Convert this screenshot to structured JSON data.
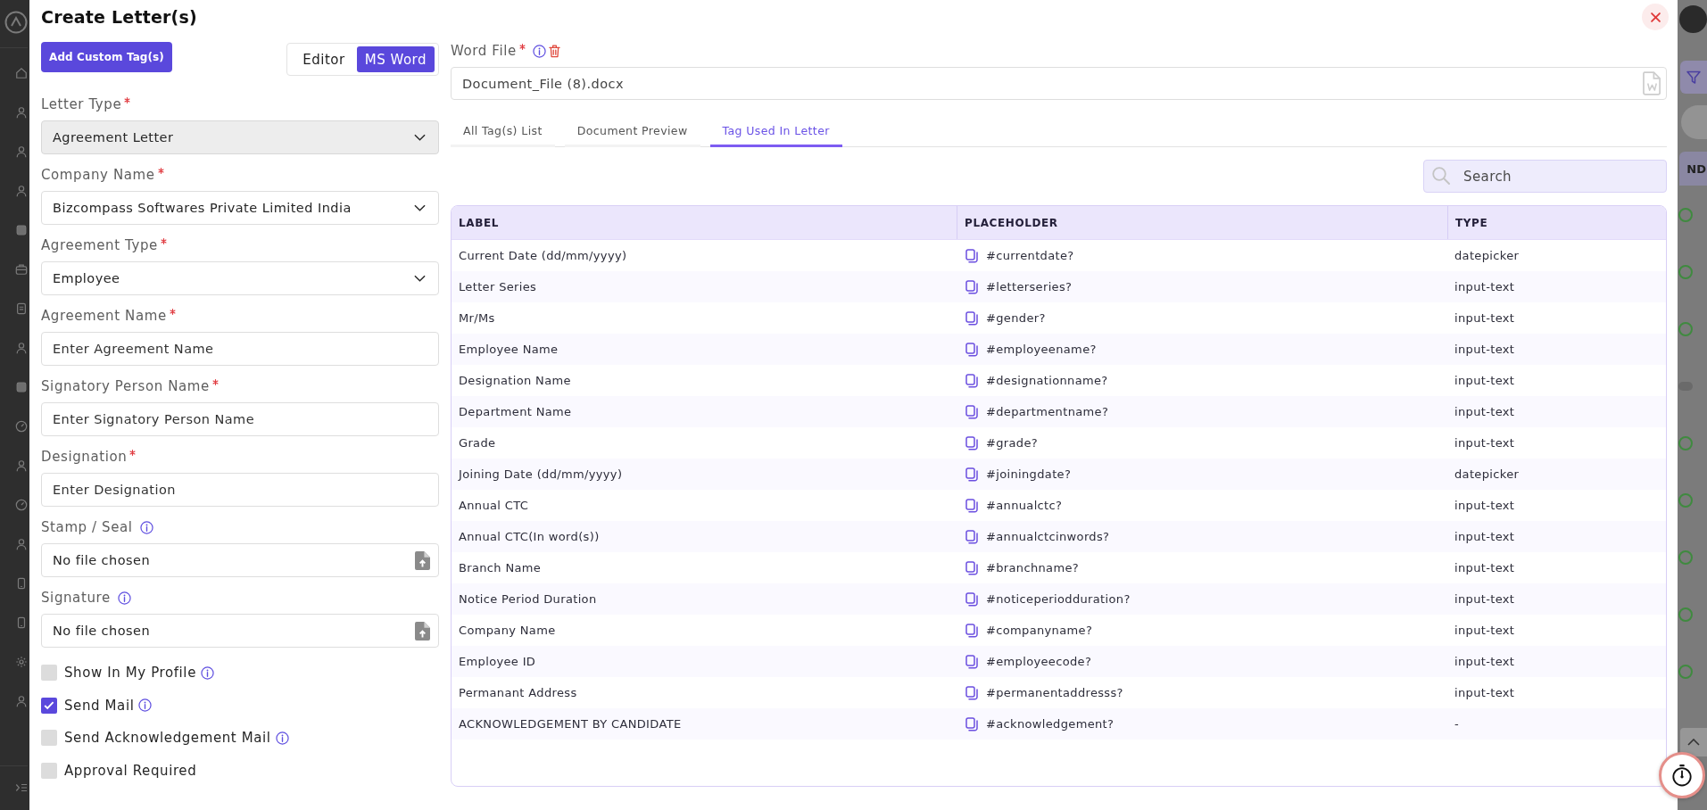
{
  "dialog": {
    "title": "Create Letter(s)"
  },
  "toolbar": {
    "add_button": "Add Custom Tag(s)",
    "modes": [
      {
        "label": "Editor",
        "selected": false
      },
      {
        "label": "MS Word",
        "selected": true
      }
    ]
  },
  "form_fields": [
    {
      "kind": "select",
      "label": "Letter Type",
      "required": true,
      "info": false,
      "value": "Agreement Letter",
      "disabled": true
    },
    {
      "kind": "select",
      "label": "Company Name",
      "required": true,
      "info": false,
      "value": "Bizcompass Softwares Private Limited India",
      "disabled": false
    },
    {
      "kind": "select",
      "label": "Agreement Type",
      "required": true,
      "info": false,
      "value": "Employee",
      "disabled": false
    },
    {
      "kind": "text",
      "label": "Agreement Name",
      "required": true,
      "info": false,
      "placeholder": "Enter Agreement Name",
      "disabled": false
    },
    {
      "kind": "text",
      "label": "Signatory Person Name",
      "required": true,
      "info": false,
      "placeholder": "Enter Signatory Person Name",
      "disabled": false
    },
    {
      "kind": "text",
      "label": "Designation",
      "required": true,
      "info": false,
      "placeholder": "Enter Designation",
      "disabled": false
    },
    {
      "kind": "file",
      "label": "Stamp / Seal",
      "required": false,
      "info": true,
      "value": "No file chosen",
      "disabled": false
    },
    {
      "kind": "file",
      "label": "Signature",
      "required": false,
      "info": true,
      "value": "No file chosen",
      "disabled": false
    }
  ],
  "options": [
    {
      "label": "Show In My Profile",
      "checked": false,
      "info": true
    },
    {
      "label": "Send Mail",
      "checked": true,
      "info": true
    },
    {
      "label": "Send Acknowledgement Mail",
      "checked": false,
      "info": true
    },
    {
      "label": "Approval Required",
      "checked": false,
      "info": false
    }
  ],
  "word_file": {
    "label": "Word File",
    "required": true,
    "info": true,
    "value": "Document_File (8).docx"
  },
  "tabs": [
    {
      "label": "All Tag(s) List",
      "selected": false
    },
    {
      "label": "Document Preview",
      "selected": false
    },
    {
      "label": "Tag Used In Letter",
      "selected": true
    }
  ],
  "search": {
    "placeholder": "Search"
  },
  "table": {
    "columns": [
      "LABEL",
      "PLACEHOLDER",
      "TYPE"
    ],
    "rows": [
      {
        "label": "Current Date (dd/mm/yyyy)",
        "tag": "#currentdate?",
        "type": "datepicker"
      },
      {
        "label": "Letter Series",
        "tag": "#letterseries?",
        "type": "input-text"
      },
      {
        "label": "Mr/Ms",
        "tag": "#gender?",
        "type": "input-text"
      },
      {
        "label": "Employee Name",
        "tag": "#employeename?",
        "type": "input-text"
      },
      {
        "label": "Designation Name",
        "tag": "#designationname?",
        "type": "input-text"
      },
      {
        "label": "Department Name",
        "tag": "#departmentname?",
        "type": "input-text"
      },
      {
        "label": "Grade",
        "tag": "#grade?",
        "type": "input-text"
      },
      {
        "label": "Joining Date (dd/mm/yyyy)",
        "tag": "#joiningdate?",
        "type": "datepicker"
      },
      {
        "label": "Annual CTC",
        "tag": "#annualctc?",
        "type": "input-text"
      },
      {
        "label": "Annual CTC(In word(s))",
        "tag": "#annualctcinwords?",
        "type": "input-text"
      },
      {
        "label": "Branch Name",
        "tag": "#branchname?",
        "type": "input-text"
      },
      {
        "label": "Notice Period Duration",
        "tag": "#noticeperiodduration?",
        "type": "input-text"
      },
      {
        "label": "Company Name",
        "tag": "#companyname?",
        "type": "input-text"
      },
      {
        "label": "Employee ID",
        "tag": "#employeecode?",
        "type": "input-text"
      },
      {
        "label": "Permanant Address",
        "tag": "#permanentaddresss?",
        "type": "input-text"
      },
      {
        "label": "ACKNOWLEDGEMENT BY CANDIDATE",
        "tag": "#acknowledgement?",
        "type": "-"
      }
    ]
  },
  "backdrop": {
    "column_header_fragment": "ND"
  }
}
